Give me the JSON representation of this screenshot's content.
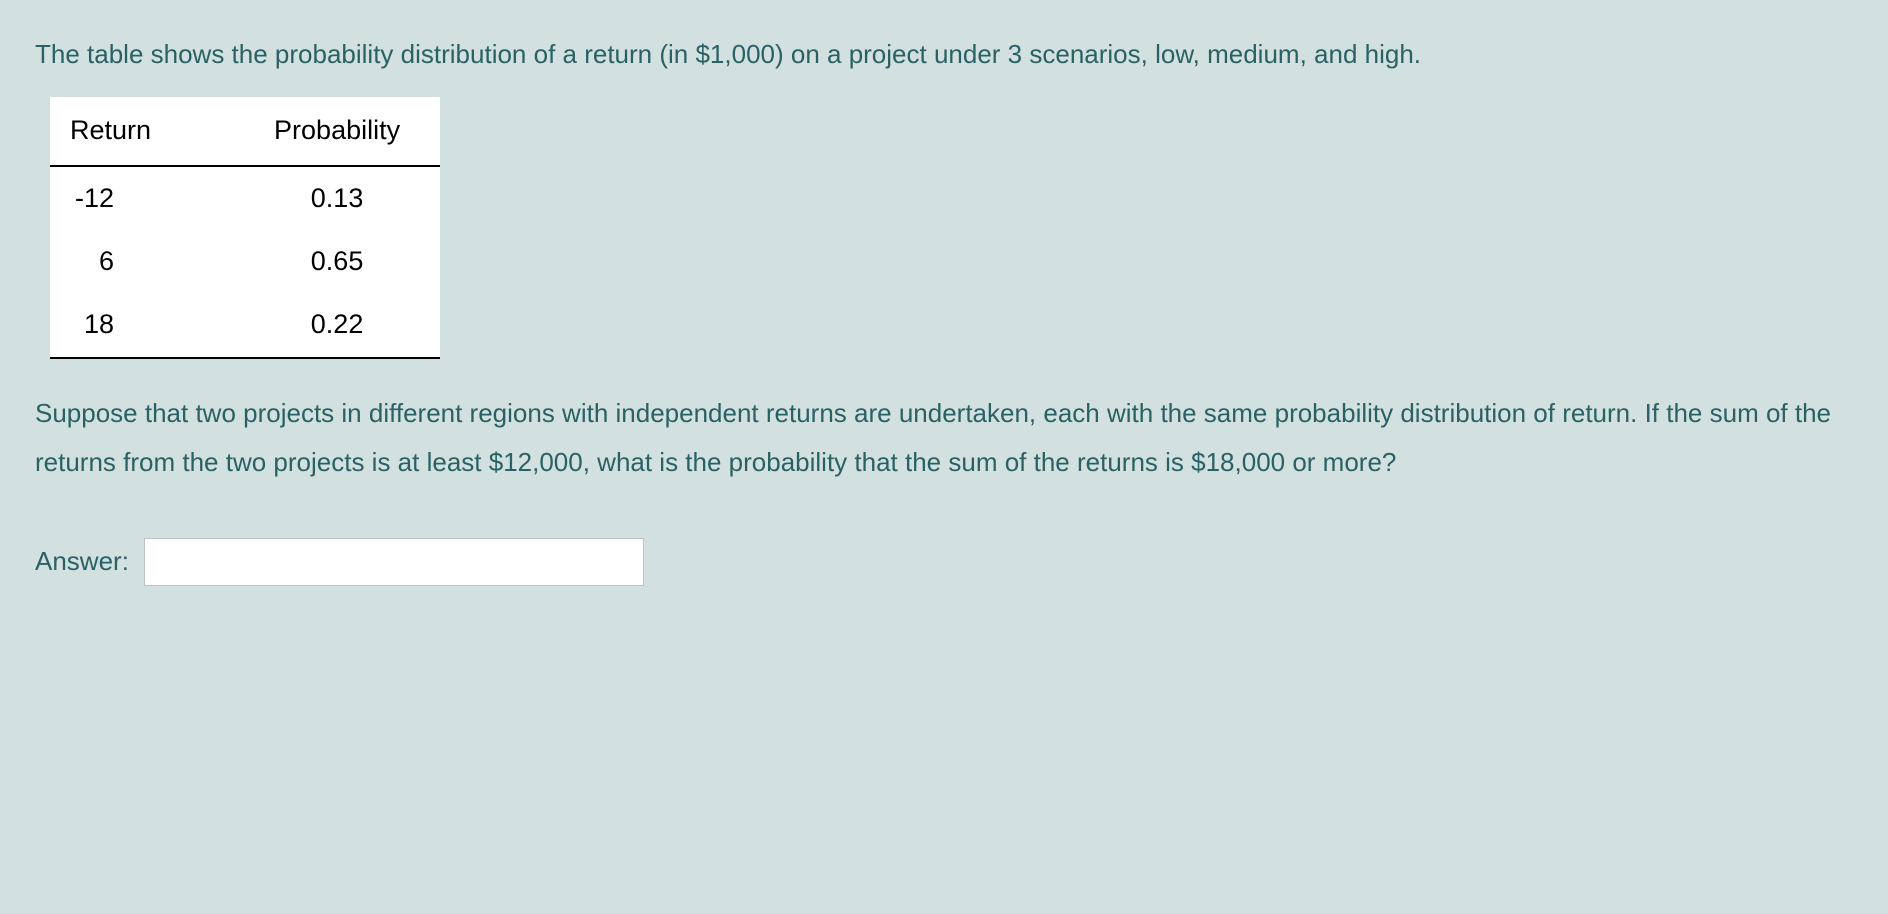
{
  "question": {
    "intro": "The table shows the probability distribution of a return (in $1,000) on a project under 3 scenarios, low, medium, and high.",
    "body": "Suppose that two projects in different regions with independent returns are undertaken, each with the same probability distribution of return. If the sum of the returns from the two projects is at least $12,000, what is the probability that the sum of the returns is $18,000 or more?"
  },
  "table": {
    "headers": {
      "col1": "Return",
      "col2": "Probability"
    },
    "rows": [
      {
        "return": "-12",
        "probability": "0.13"
      },
      {
        "return": "6",
        "probability": "0.65"
      },
      {
        "return": "18",
        "probability": "0.22"
      }
    ]
  },
  "answer": {
    "label": "Answer:",
    "value": ""
  }
}
